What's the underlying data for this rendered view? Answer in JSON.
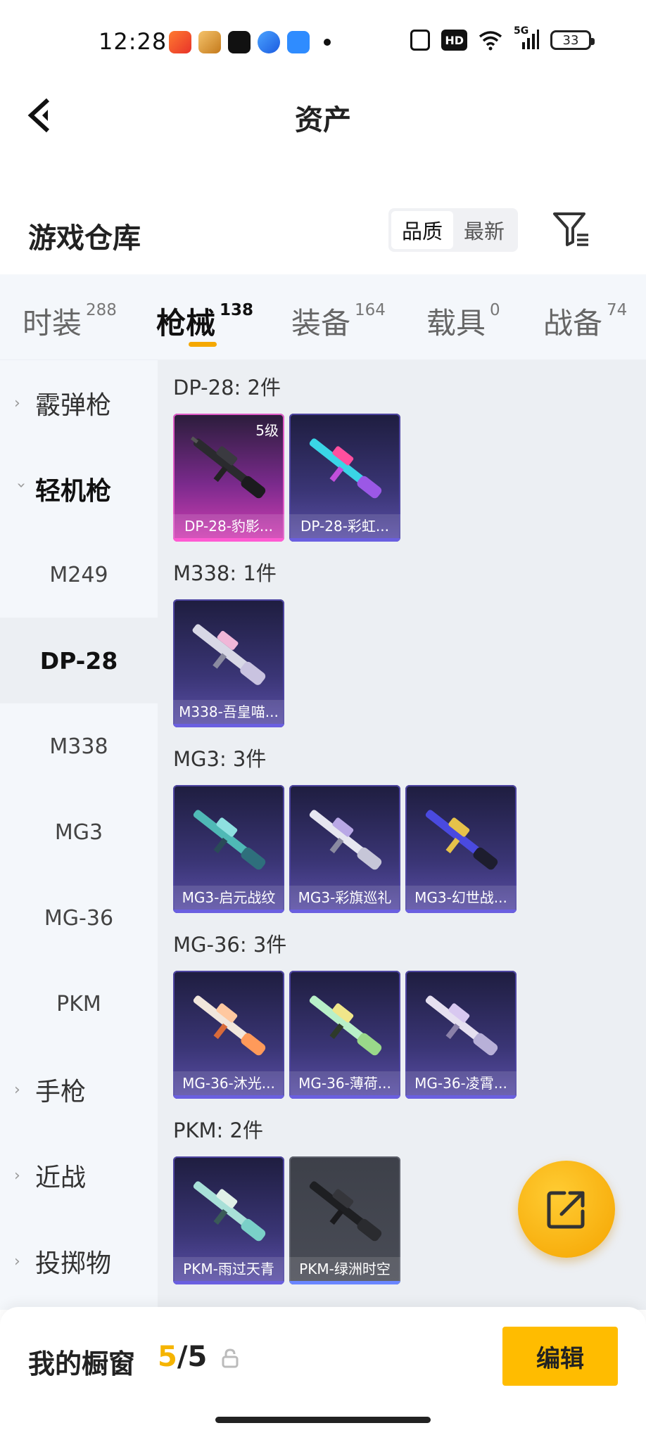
{
  "status_bar": {
    "time": "12:28",
    "network": "5G",
    "hd": "HD",
    "battery": "33"
  },
  "header": {
    "title": "资产"
  },
  "warehouse": {
    "title": "游戏仓库",
    "sort_options": [
      "品质",
      "最新"
    ],
    "sort_active": "品质"
  },
  "tabs": [
    {
      "label": "时装",
      "count": "288"
    },
    {
      "label": "枪械",
      "count": "138"
    },
    {
      "label": "装备",
      "count": "164"
    },
    {
      "label": "载具",
      "count": "0"
    },
    {
      "label": "战备",
      "count": "74"
    }
  ],
  "active_tab": "枪械",
  "sidebar": {
    "categories": [
      {
        "label": "霰弹枪",
        "type": "parent",
        "state": "collapsed"
      },
      {
        "label": "轻机枪",
        "type": "parent",
        "state": "expanded"
      },
      {
        "label": "M249",
        "type": "sub"
      },
      {
        "label": "DP-28",
        "type": "sub",
        "active": true
      },
      {
        "label": "M338",
        "type": "sub"
      },
      {
        "label": "MG3",
        "type": "sub"
      },
      {
        "label": "MG-36",
        "type": "sub"
      },
      {
        "label": "PKM",
        "type": "sub"
      },
      {
        "label": "手枪",
        "type": "parent",
        "state": "collapsed"
      },
      {
        "label": "近战",
        "type": "parent",
        "state": "collapsed"
      },
      {
        "label": "投掷物",
        "type": "parent",
        "state": "collapsed"
      }
    ]
  },
  "groups": [
    {
      "title": "DP-28: 2件",
      "items": [
        {
          "name": "DP-28-豹影...",
          "rarity": "pink",
          "level": "5级"
        },
        {
          "name": "DP-28-彩虹...",
          "rarity": "purple"
        }
      ]
    },
    {
      "title": "M338: 1件",
      "items": [
        {
          "name": "M338-吾皇喵...",
          "rarity": "purple"
        }
      ]
    },
    {
      "title": "MG3: 3件",
      "items": [
        {
          "name": "MG3-启元战纹",
          "rarity": "purple"
        },
        {
          "name": "MG3-彩旗巡礼",
          "rarity": "purple"
        },
        {
          "name": "MG3-幻世战...",
          "rarity": "purple"
        }
      ]
    },
    {
      "title": "MG-36: 3件",
      "items": [
        {
          "name": "MG-36-沐光...",
          "rarity": "purple"
        },
        {
          "name": "MG-36-薄荷...",
          "rarity": "purple"
        },
        {
          "name": "MG-36-凌霄...",
          "rarity": "purple"
        }
      ]
    },
    {
      "title": "PKM: 2件",
      "items": [
        {
          "name": "PKM-雨过天青",
          "rarity": "purple"
        },
        {
          "name": "PKM-绿洲时空",
          "rarity": "gray"
        }
      ]
    }
  ],
  "showcase": {
    "label": "我的橱窗",
    "current": "5",
    "separator": "/",
    "max": "5",
    "edit_label": "编辑"
  },
  "colors": {
    "accent": "#f5a800",
    "edit_button": "#ffbc00",
    "rarity_pink": "#d43fb4",
    "rarity_purple": "#5b4fa8",
    "rarity_gray": "#4a4d57"
  }
}
